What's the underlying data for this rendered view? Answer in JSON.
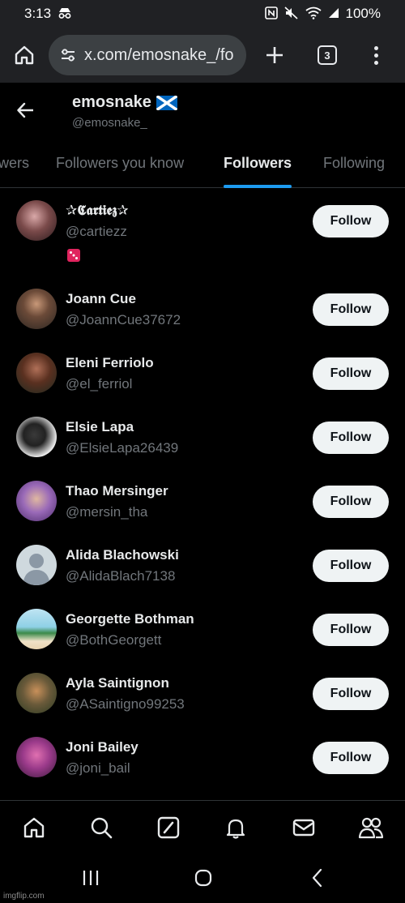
{
  "status_bar": {
    "time": "3:13",
    "battery": "100%"
  },
  "browser": {
    "url": "x.com/emosnake_/fo",
    "tab_count": "3"
  },
  "profile": {
    "name": "emosnake",
    "handle": "@emosnake_"
  },
  "tabs": [
    {
      "label": "wers"
    },
    {
      "label": "Followers you know"
    },
    {
      "label": "Followers"
    },
    {
      "label": "Following"
    }
  ],
  "follow_label": "Follow",
  "users": [
    {
      "name": "✰𝕮𝖆𝖗𝖙𝖎𝖊𝖟✰",
      "handle": "@cartiezz",
      "bio": "🎲"
    },
    {
      "name": "Joann Cue",
      "handle": "@JoannCue37672"
    },
    {
      "name": "Eleni Ferriolo",
      "handle": "@el_ferriol"
    },
    {
      "name": "Elsie Lapa",
      "handle": "@ElsieLapa26439"
    },
    {
      "name": "Thao Mersinger",
      "handle": "@mersin_tha"
    },
    {
      "name": "Alida Blachowski",
      "handle": "@AlidaBlach7138"
    },
    {
      "name": "Georgette Bothman",
      "handle": "@BothGeorgett"
    },
    {
      "name": "Ayla Saintignon",
      "handle": "@ASaintigno99253"
    },
    {
      "name": "Joni Bailey",
      "handle": "@joni_bail"
    }
  ],
  "watermark": "imgflip.com",
  "colors": {
    "accent": "#1d9bf0",
    "background": "#000000",
    "secondary_text": "#71767b",
    "button_bg": "#eff3f4"
  }
}
